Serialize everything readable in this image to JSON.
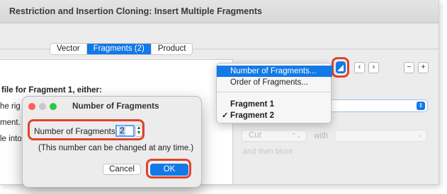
{
  "window": {
    "title": "Restriction and Insertion Cloning: Insert Multiple Fragments"
  },
  "tabs": [
    {
      "label": "Vector",
      "selected": false
    },
    {
      "label": "Fragments (2)",
      "selected": true
    },
    {
      "label": "Product",
      "selected": false
    }
  ],
  "left_panel": {
    "heading": "file for Fragment 1, either:",
    "line1": "he rig",
    "line2": "ment.",
    "line3": "le into"
  },
  "right_panel": {
    "stepper_minus": "−",
    "stepper_plus": "+",
    "nav_prev": "‹",
    "nav_next": "›",
    "cut_select": "Cut",
    "with_label": "with",
    "faint_text": "and then blunt"
  },
  "menu": {
    "items": [
      {
        "label": "Number of Fragments...",
        "highlighted": true
      },
      {
        "label": "Order of Fragments...",
        "highlighted": false
      },
      {
        "label": "Fragment 1",
        "checked": false
      },
      {
        "label": "Fragment 2",
        "checked": true
      }
    ],
    "check_glyph": "✓"
  },
  "dialog": {
    "title": "Number of Fragments",
    "field_label": "Number of Fragments:",
    "field_value": "2",
    "note": "(This number can be changed at any time.)",
    "cancel_label": "Cancel",
    "ok_label": "OK"
  },
  "colors": {
    "accent": "#1279e6",
    "highlight_ring": "#e0442a",
    "traffic_red": "#ff5f57",
    "traffic_yellow": "#c8c8c8",
    "traffic_green": "#28c840"
  }
}
